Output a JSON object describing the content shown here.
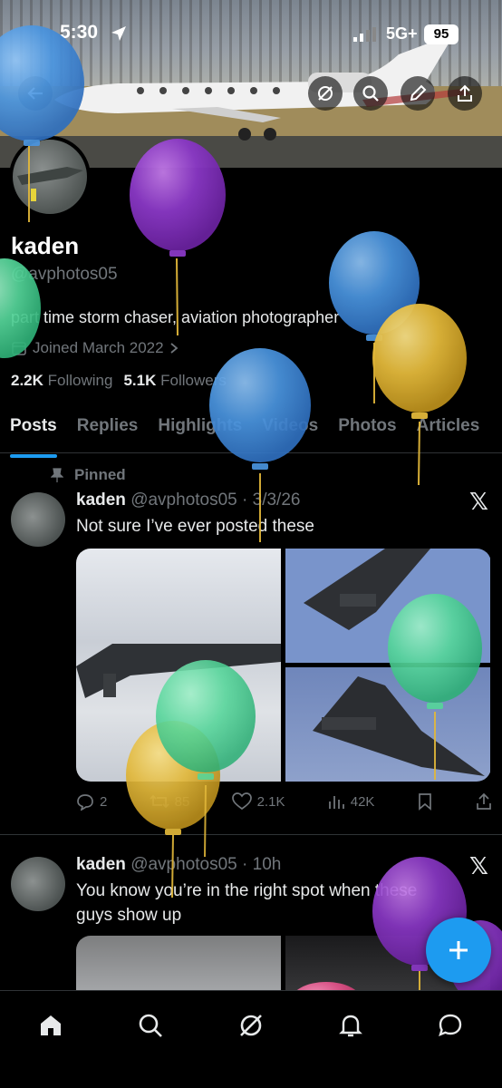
{
  "status": {
    "time": "5:30",
    "network": "5G+",
    "battery": "95"
  },
  "profile": {
    "name": "kaden",
    "handle": "@avphotos05",
    "bio": "part time storm chaser, aviation photographer",
    "joined": "Joined March 2022",
    "following_count": "2.2K",
    "following_label": "Following",
    "followers_count": "5.1K",
    "followers_label": "Followers"
  },
  "tabs": [
    {
      "label": "Posts",
      "active": true
    },
    {
      "label": "Replies"
    },
    {
      "label": "Highlights"
    },
    {
      "label": "Videos"
    },
    {
      "label": "Photos"
    },
    {
      "label": "Articles"
    }
  ],
  "posts": [
    {
      "pinned_label": "Pinned",
      "name": "kaden",
      "handle": "@avphotos05",
      "time": "3/3/26",
      "text": "Not sure I’ve ever posted these",
      "replies": "2",
      "reposts": "85",
      "likes": "2.1K",
      "views": "42K"
    },
    {
      "name": "kaden",
      "handle": "@avphotos05",
      "time": "10h",
      "text": "You know you’re in the right spot when these guys show up"
    }
  ],
  "colors": {
    "accent": "#1d9bf0",
    "balloon_blue": "#4a95e0",
    "balloon_purple": "#8a38c6",
    "balloon_green": "#55d69a",
    "balloon_yellow": "#e2b83a",
    "balloon_pink": "#e0548a"
  },
  "icons": {
    "home": "home-icon",
    "search": "search-icon",
    "grok": "grok-icon",
    "notifications": "bell-icon",
    "messages": "message-icon"
  }
}
